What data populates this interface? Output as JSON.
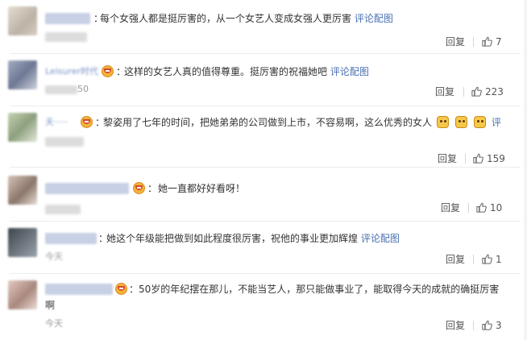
{
  "comments": [
    {
      "username": "········",
      "text": "每个女强人都是挺厉害的，从一个女艺人变成女强人更厉害",
      "pic_link": "评论配图",
      "reply_label": "回复",
      "likes": "7",
      "avatar_colors": [
        "#d9cfc2",
        "#b8b0a6"
      ]
    },
    {
      "username": "Leisurer时代",
      "text": "这样的女艺人真的值得尊重。挺厉害的祝福她吧",
      "pic_link": "评论配图",
      "time_suffix": "50",
      "reply_label": "回复",
      "likes": "223",
      "avatar_colors": [
        "#9aa3b8",
        "#c6cbd6"
      ]
    },
    {
      "username": "夭·····",
      "text": "黎姿用了七年的时间，把她弟弟的公司做到上市，不容易啊，这么优秀的女人",
      "pic_link_partial": "评",
      "reply_label": "回复",
      "likes": "159",
      "avatar_colors": [
        "#b9c7a8",
        "#8a9a7c"
      ]
    },
    {
      "username": "··········",
      "text": "她一直都好好看呀！",
      "reply_label": "回复",
      "likes": "10",
      "avatar_colors": [
        "#c9b4a8",
        "#8e7a6e"
      ]
    },
    {
      "username": "········",
      "text": "她这个年级能把做到如此程度很厉害，祝他的事业更加辉煌",
      "pic_link": "评论配图",
      "time_prefix": "今天",
      "reply_label": "回复",
      "likes": "1",
      "avatar_colors": [
        "#4a5058",
        "#7d8690"
      ]
    },
    {
      "username": "·········",
      "text": "50岁的年纪摆在那儿，不能当艺人，那只能做事业了，能取得今天的成就的确挺厉害",
      "text_line2": "啊",
      "time_prefix": "今天",
      "reply_label": "回复",
      "likes": "3",
      "avatar_colors": [
        "#d7b9b0",
        "#a88a80"
      ]
    }
  ],
  "colors": {
    "link": "#4a6fb1",
    "username": "#7a93c8",
    "text": "#333333",
    "meta": "#9a9a9a",
    "divider": "#ececec"
  },
  "icons": {
    "like": "thumbs-up-icon",
    "badge": "vip-badge-icon",
    "emoji": "cat-face-emoji-icon"
  }
}
